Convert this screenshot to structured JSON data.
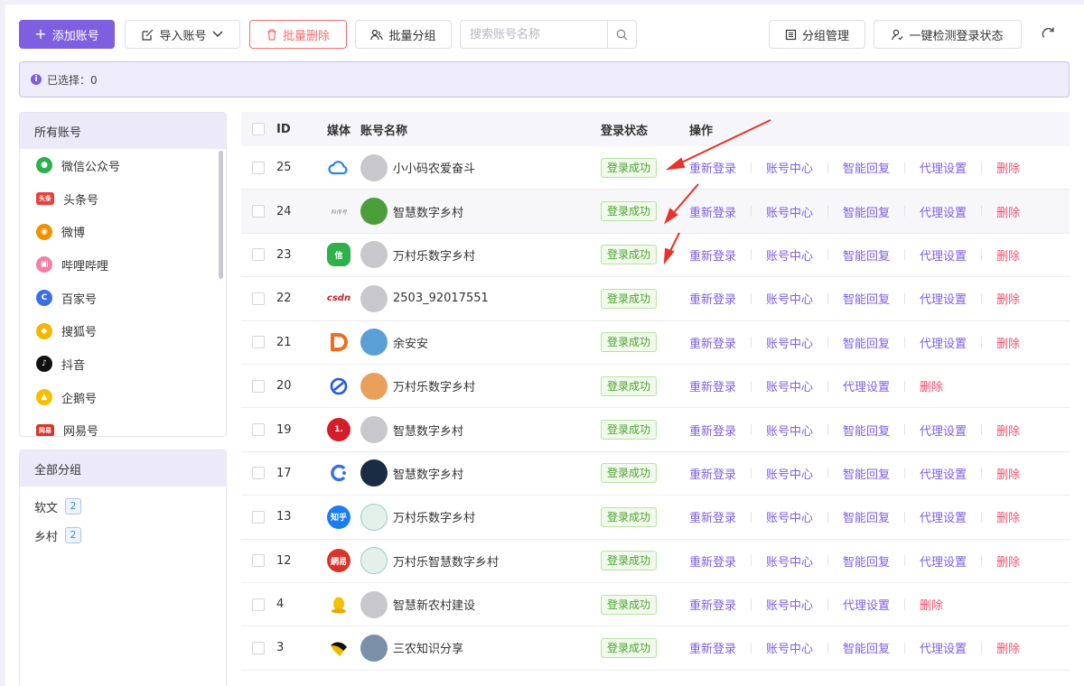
{
  "toolbar": {
    "add_label": "添加账号",
    "import_label": "导入账号",
    "batch_delete_label": "批量删除",
    "batch_group_label": "批量分组",
    "search_placeholder": "搜索账号名称",
    "group_manage_label": "分组管理",
    "check_login_label": "一键检测登录状态"
  },
  "selection": {
    "text": "已选择：0"
  },
  "media_panel": {
    "title": "所有账号",
    "items": [
      {
        "label": "微信公众号",
        "icon": "wechat-icon",
        "color": "#2bb24c"
      },
      {
        "label": "头条号",
        "icon": "toutiao-icon",
        "color": "#e8403b"
      },
      {
        "label": "微博",
        "icon": "weibo-icon",
        "color": "#f29100"
      },
      {
        "label": "哔哩哔哩",
        "icon": "bilibili-icon",
        "color": "#f17fa8"
      },
      {
        "label": "百家号",
        "icon": "baijiahao-icon",
        "color": "#3a6fe0"
      },
      {
        "label": "搜狐号",
        "icon": "sohu-icon",
        "color": "#f3b700"
      },
      {
        "label": "抖音",
        "icon": "douyin-icon",
        "color": "#111111"
      },
      {
        "label": "企鹅号",
        "icon": "qie-icon",
        "color": "#f5c000"
      },
      {
        "label": "网易号",
        "icon": "netease-icon",
        "color": "#d8352a"
      }
    ]
  },
  "group_panel": {
    "title": "全部分组",
    "items": [
      {
        "label": "软文",
        "count": "2"
      },
      {
        "label": "乡村",
        "count": "2"
      }
    ]
  },
  "table": {
    "headers": {
      "id": "ID",
      "media": "媒体",
      "name": "账号名称",
      "status": "登录状态",
      "ops": "操作"
    },
    "op_labels": {
      "relogin": "重新登录",
      "center": "账号中心",
      "smart_reply": "智能回复",
      "proxy": "代理设置",
      "delete": "删除"
    },
    "rows": [
      {
        "id": "25",
        "media": "cloud",
        "name": "小小码农爱奋斗",
        "status": "登录成功",
        "smart_reply": true
      },
      {
        "id": "24",
        "media": "small-text",
        "name": "智慧数字乡村",
        "status": "登录成功",
        "smart_reply": true
      },
      {
        "id": "23",
        "media": "xin",
        "name": "万村乐数字乡村",
        "status": "登录成功",
        "smart_reply": true
      },
      {
        "id": "22",
        "media": "csdn",
        "name": "2503_92017551",
        "status": "登录成功",
        "smart_reply": true
      },
      {
        "id": "21",
        "media": "d-orange",
        "name": "余安安",
        "status": "登录成功",
        "smart_reply": true
      },
      {
        "id": "20",
        "media": "blue-loop",
        "name": "万村乐数字乡村",
        "status": "登录成功",
        "smart_reply": false
      },
      {
        "id": "19",
        "media": "red-one",
        "name": "智慧数字乡村",
        "status": "登录成功",
        "smart_reply": true
      },
      {
        "id": "17",
        "media": "baijia",
        "name": "智慧数字乡村",
        "status": "登录成功",
        "smart_reply": true
      },
      {
        "id": "13",
        "media": "zhihu",
        "name": "万村乐数字乡村",
        "status": "登录成功",
        "smart_reply": true
      },
      {
        "id": "12",
        "media": "wangyi",
        "name": "万村乐智慧数字乡村",
        "status": "登录成功",
        "smart_reply": true
      },
      {
        "id": "4",
        "media": "qie",
        "name": "智慧新农村建设",
        "status": "登录成功",
        "smart_reply": false
      },
      {
        "id": "3",
        "media": "sohu",
        "name": "三农知识分享",
        "status": "登录成功",
        "smart_reply": true
      }
    ]
  },
  "media_logos": {
    "small-text": "科传号",
    "csdn": "csdn",
    "zhihu": "知乎",
    "wangyi": "網易"
  },
  "panel_icon_text": {
    "toutiao": "头条",
    "netease": "网易"
  },
  "colors": {
    "accent": "#7d5fe0",
    "danger": "#f0506e",
    "success": "#4aa32e",
    "arrow": "#e8332a"
  }
}
